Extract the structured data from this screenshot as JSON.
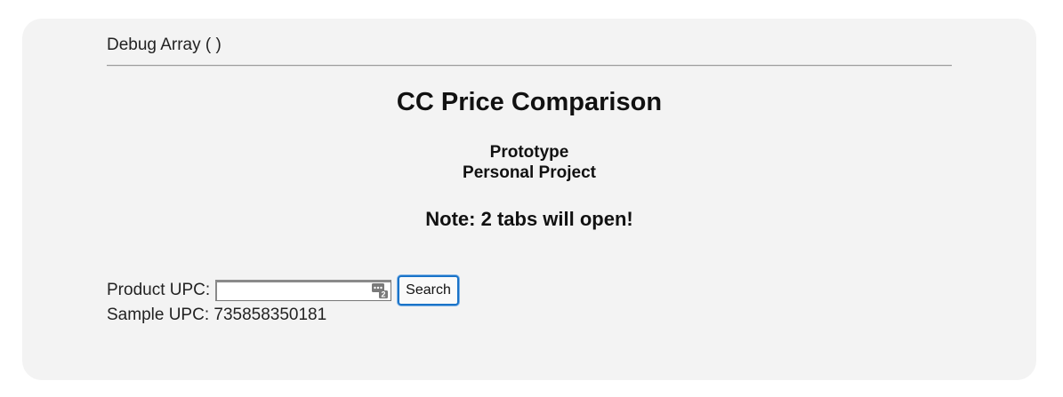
{
  "debug": {
    "label": "Debug Array ( )"
  },
  "header": {
    "title": "CC Price Comparison",
    "subtitle_line1": "Prototype",
    "subtitle_line2": "Personal Project",
    "note": "Note: 2 tabs will open!"
  },
  "form": {
    "upc_label": "Product UPC:",
    "upc_value": "",
    "upc_placeholder": "",
    "autofill_icon": "password-manager-icon",
    "autofill_badge": "2",
    "search_label": "Search",
    "sample_label": "Sample UPC: 735858350181"
  },
  "colors": {
    "panel_bg": "#f3f3f3",
    "button_focus": "#1a73c8"
  }
}
